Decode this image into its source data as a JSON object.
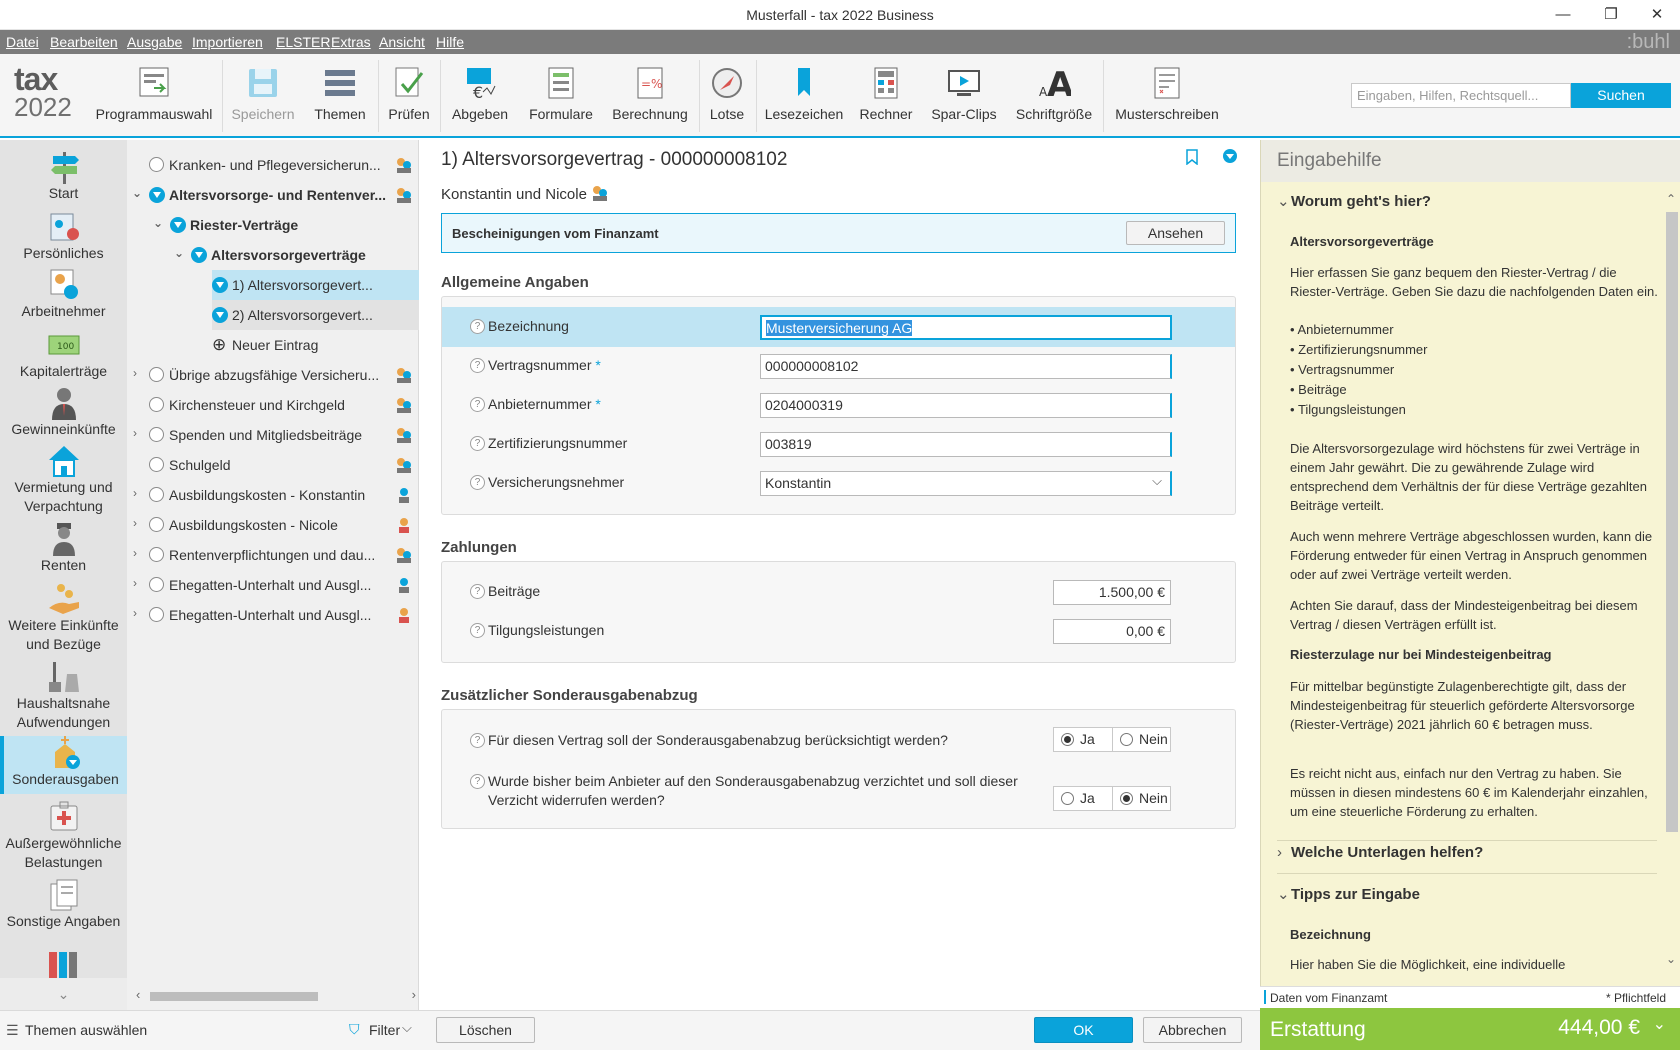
{
  "window": {
    "title": "Musterfall - tax 2022 Business",
    "min": "—",
    "max": "❐",
    "close": "✕"
  },
  "menu": [
    "Datei",
    "Bearbeiten",
    "Ausgabe",
    "Importieren",
    "ELSTER",
    "Extras",
    "Ansicht",
    "Hilfe"
  ],
  "brand": ":buhl",
  "logo": {
    "line1": "tax",
    "line2": "2022"
  },
  "toolbar": {
    "programmauswahl": "Programmauswahl",
    "speichern": "Speichern",
    "themen": "Themen",
    "pruefen": "Prüfen",
    "abgeben": "Abgeben",
    "formulare": "Formulare",
    "berechnung": "Berechnung",
    "lotse": "Lotse",
    "lesezeichen": "Lesezeichen",
    "rechner": "Rechner",
    "sparclips": "Spar-Clips",
    "schriftgroesse": "Schriftgröße",
    "musterschreiben": "Musterschreiben"
  },
  "search": {
    "placeholder": "Eingaben, Hilfen, Rechtsquell...",
    "button": "Suchen"
  },
  "leftnav": [
    "Start",
    "Persönliches",
    "Arbeitnehmer",
    "Kapitalerträge",
    "Gewinneinkünfte",
    "Vermietung und Verpachtung",
    "Renten",
    "Weitere Einkünfte und Bezüge",
    "Haushaltsnahe Aufwendungen",
    "Sonderausgaben",
    "Außergewöhnliche Belastungen",
    "Sonstige Angaben"
  ],
  "leftnav_active": "Sonderausgaben",
  "tree": [
    "Kranken- und Pflegeversicherun...",
    "Altersvorsorge- und Rentenver...",
    "Riester-Verträge",
    "Altersvorsorgeverträge",
    "1) Altersvorsorgevert...",
    "2) Altersvorsorgevert...",
    "Neuer Eintrag",
    "Übrige abzugsfähige Versicheru...",
    "Kirchensteuer und Kirchgeld",
    "Spenden und Mitgliedsbeiträge",
    "Schulgeld",
    "Ausbildungskosten - Konstantin",
    "Ausbildungskosten - Nicole",
    "Rentenverpflichtungen und dau...",
    "Ehegatten-Unterhalt und Ausgl...",
    "Ehegatten-Unterhalt und Ausgl..."
  ],
  "bottom": {
    "themen": "Themen auswählen",
    "filter": "Filter",
    "loeschen": "Löschen",
    "ok": "OK",
    "abbrechen": "Abbrechen"
  },
  "form": {
    "title": "1) Altersvorsorgevertrag - 000000008102",
    "persons": "Konstantin und Nicole",
    "info_title": "Bescheinigungen vom Finanzamt",
    "info_button": "Ansehen",
    "section1": "Allgemeine Angaben",
    "bezeichnung_label": "Bezeichnung",
    "bezeichnung_value": "Musterversicherung AG",
    "vertragsnummer_label": "Vertragsnummer",
    "vertragsnummer_value": "000000008102",
    "anbieternummer_label": "Anbieternummer",
    "anbieternummer_value": "0204000319",
    "zertifizierungsnummer_label": "Zertifizierungsnummer",
    "zertifizierungsnummer_value": "003819",
    "versicherungsnehmer_label": "Versicherungsnehmer",
    "versicherungsnehmer_value": "Konstantin",
    "required_mark": "*",
    "section2": "Zahlungen",
    "beitraege_label": "Beiträge",
    "beitraege_value": "1.500,00 €",
    "tilgung_label": "Tilgungsleistungen",
    "tilgung_value": "0,00 €",
    "section3": "Zusätzlicher Sonderausgabenabzug",
    "q1": "Für diesen Vertrag soll der Sonderausgabenabzug berücksichtigt werden?",
    "q1_answer": "Ja",
    "q2_line1": "Wurde bisher beim Anbieter auf den Sonderausgabenabzug verzichtet und soll dieser",
    "q2_line2": "Verzicht widerrufen werden?",
    "q2_answer": "Nein",
    "yes": "Ja",
    "no": "Nein"
  },
  "help": {
    "title": "Eingabehilfe",
    "s1": "Worum geht's hier?",
    "p_head": "Altersvorsorgeverträge",
    "p1": "Hier erfassen Sie ganz bequem den Riester-Vertrag / die Riester-Verträge. Geben Sie dazu die nachfolgenden Daten ein.",
    "bullets": [
      "Anbieternummer",
      "Zertifizierungsnummer",
      "Vertragsnummer",
      "Beiträge",
      "Tilgungsleistungen"
    ],
    "p2": "Die Altersvorsorgezulage wird höchstens für zwei Verträge in einem Jahr gewährt. Die zu gewährende Zulage wird entsprechend dem Verhältnis der für diese Verträge gezahlten Beiträge verteilt.",
    "p3": "Auch wenn mehrere Verträge abgeschlossen wurden, kann die Förderung entweder für einen Vertrag in Anspruch genommen oder auf zwei Verträge verteilt werden.",
    "p4": "Achten Sie darauf, dass der Mindesteigenbeitrag bei diesem Vertrag / diesen Verträgen erfüllt ist.",
    "p_head2": "Riesterzulage nur bei Mindesteigenbeitrag",
    "p5": "Für mittelbar begünstigte Zulagenberechtigte gilt, dass der Mindesteigenbeitrag für steuerlich geförderte Altersvorsorge (Riester-Verträge) 2021 jährlich 60 € betragen muss.",
    "p6": "Es reicht nicht aus, einfach nur den Vertrag zu haben. Sie müssen in diesen mindestens 60 € im Kalenderjahr einzahlen, um eine steuerliche Förderung zu erhalten.",
    "s2": "Welche Unterlagen helfen?",
    "s3": "Tipps zur Eingabe",
    "p_head3": "Bezeichnung",
    "p7": "Hier haben Sie die Möglichkeit, eine individuelle",
    "foot_left": "Daten vom Finanzamt",
    "foot_right": "* Pflichtfeld"
  },
  "refund": {
    "label": "Erstattung",
    "amount": "444,00 €"
  },
  "colors": {
    "accent": "#0aa3da",
    "refund": "#8dc63f",
    "help_bg": "#f7f4d4",
    "selection": "#bfe4f3"
  }
}
